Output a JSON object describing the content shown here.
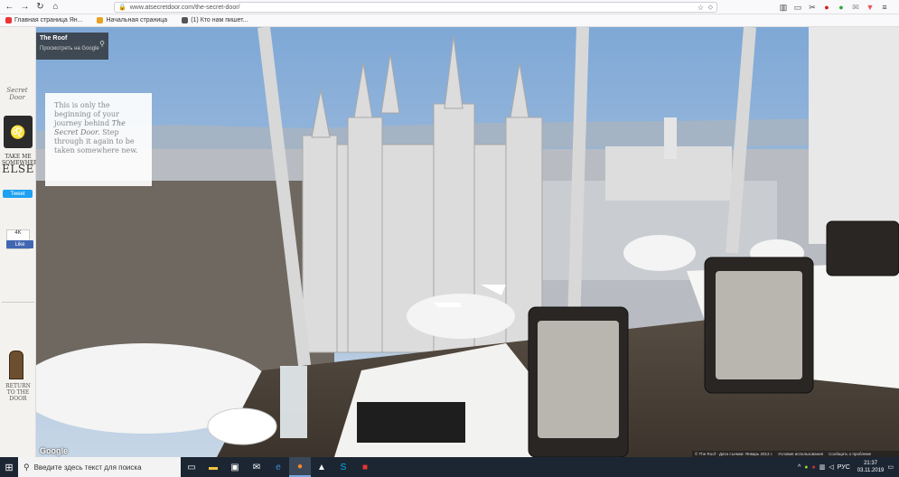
{
  "browser": {
    "url": "www.atsecretdoor.com/the-secret-door/",
    "nav_icons": [
      "back-icon",
      "forward-icon",
      "reload-icon",
      "home-icon"
    ],
    "toolbar_icons": [
      "library-icon",
      "reader-view-icon",
      "screenshot-icon",
      "addon-icon",
      "extension-icon",
      "extension-icon",
      "extension-icon",
      "menu-icon"
    ]
  },
  "bookmarks": [
    {
      "label": "Главная страница Ян...",
      "color": "#e33"
    },
    {
      "label": "Начальная страница",
      "color": "#e8a21f"
    },
    {
      "label": "(1) Кто нам пишет...",
      "color": "#555"
    }
  ],
  "sidebar": {
    "logo_text": "Secret Door",
    "take_me": "TAKE ME SOMEWHERE",
    "else_text": "ELSE",
    "tweet_label": "Tweet",
    "like_count": "4K",
    "like_label": "Like",
    "return_text": "RETURN TO THE DOOR"
  },
  "streetview": {
    "place_title": "The Roof",
    "place_subtitle": "Просмотреть на Google",
    "google_logo": "Google",
    "footer_items": [
      "© The Roof - Дата съемки: Январь 2013 г.",
      "Условия использования",
      "Сообщить о проблеме"
    ]
  },
  "story": {
    "line1": "This is only the beginning of your journey behind",
    "signature": "The Secret Door.",
    "line2": "Step through it again to be taken somewhere new."
  },
  "taskbar": {
    "search_placeholder": "Введите здесь текст для поиска",
    "apps": [
      "task-view-icon",
      "file-explorer-icon",
      "store-icon",
      "mail-icon",
      "edge-icon",
      "firefox-icon",
      "photos-icon",
      "skype-icon",
      "app-icon"
    ],
    "tray_lang": "РУС",
    "time": "21:37",
    "date": "03.11.2019"
  },
  "colors": {
    "sky": "#8fb4da",
    "taskbar": "#1c2633",
    "accent_tweet": "#1da1f2",
    "accent_like": "#4267b2"
  }
}
